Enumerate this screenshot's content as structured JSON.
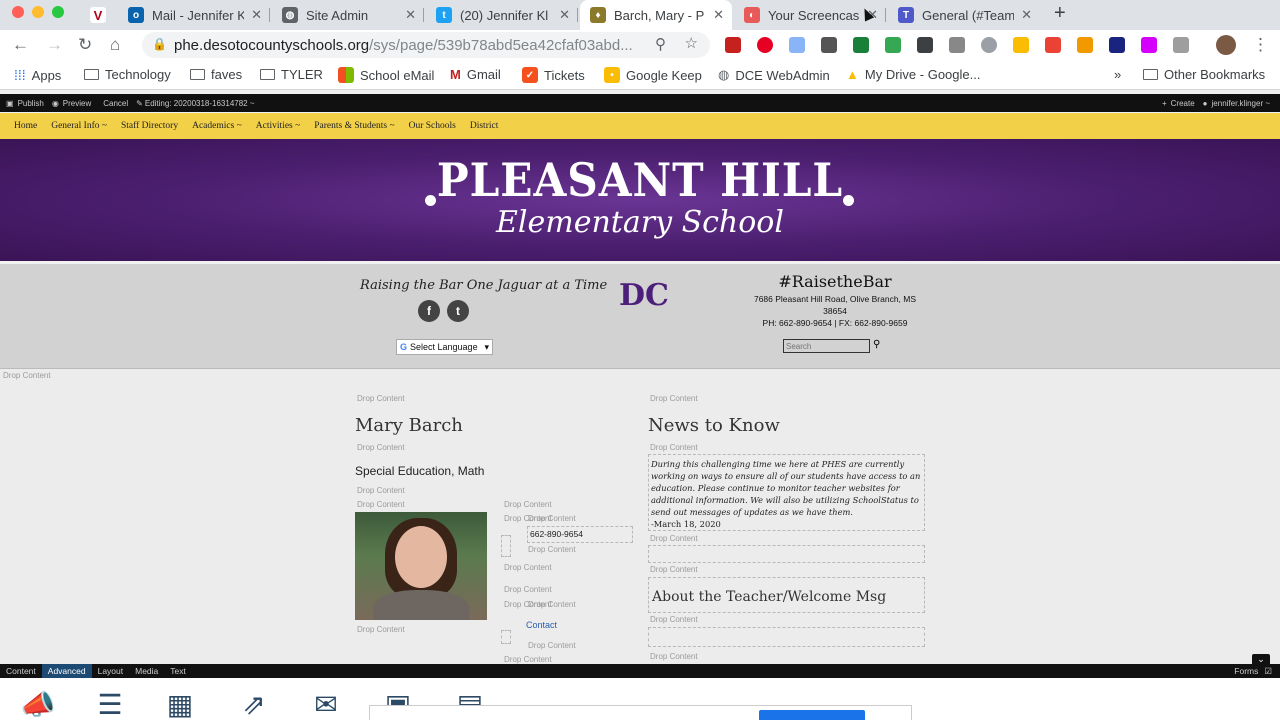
{
  "browser": {
    "tabs": [
      {
        "label": "Mail - Jennifer K",
        "icon": "outlook-icon"
      },
      {
        "label": "Site Admin",
        "icon": "globe-icon"
      },
      {
        "label": "(20) Jennifer Kl",
        "icon": "twitter-icon"
      },
      {
        "label": "Barch, Mary - P",
        "icon": "site-icon"
      },
      {
        "label": "Your Screencas",
        "icon": "screencast-icon"
      },
      {
        "label": "General (#Team",
        "icon": "teams-icon"
      }
    ],
    "new_tab": "+",
    "url_main": "phe.desotocountyschools.org",
    "url_rest": "/sys/page/539b78abd5ea42cfaf03abd...",
    "bookmarks": [
      "Apps",
      "Technology",
      "faves",
      "TYLER",
      "School eMail",
      "Gmail",
      "Tickets",
      "Google Keep",
      "DCE WebAdmin",
      "My Drive - Google..."
    ],
    "more": "»",
    "other_bookmarks": "Other Bookmarks"
  },
  "cms": {
    "publish": "Publish",
    "preview": "Preview",
    "cancel": "Cancel",
    "editing": "Editing: 20200318-16314782 ~",
    "create": "Create",
    "user": "jennifer.klinger ~"
  },
  "nav": [
    "Home",
    "General Info ~",
    "Staff Directory",
    "Academics ~",
    "Activities ~",
    "Parents & Students ~",
    "Our Schools",
    "District"
  ],
  "hero": {
    "line1": "PLEASANT HILL",
    "line2": "Elementary School"
  },
  "info": {
    "motto": "Raising the Bar One Jaguar at a Time",
    "language": "Select Language",
    "logo": "DC",
    "hashtag": "#RaisetheBar",
    "address": "7686 Pleasant Hill Road, Olive Branch, MS",
    "zip": "38654",
    "phone": "PH: 662-890-9654 | FX: 662-890-9659",
    "search_placeholder": "Search"
  },
  "content": {
    "drop": "Drop Content",
    "name": "Mary Barch",
    "subjects": "Special Education, Math",
    "phone": "662-890-9654",
    "contact": "Contact",
    "news_title": "News to Know",
    "news_text": "During this challenging time we here at PHES are currently working on ways to ensure all of our students have access to an education. Please continue to monitor teacher websites for additional information. We will also be utilizing SchoolStatus to send out messages of updates as we have them.",
    "news_date": "-March 18, 2020",
    "about_title": "About the Teacher/Welcome Msg"
  },
  "editor": {
    "tabs": [
      "Content",
      "Advanced",
      "Layout",
      "Media",
      "Text"
    ],
    "forms": "Forms",
    "tools": [
      "megaphone-icon",
      "list-icon",
      "calendar-icon",
      "share-icon",
      "envelope-icon",
      "contact-card-icon",
      "newspaper-icon"
    ]
  }
}
